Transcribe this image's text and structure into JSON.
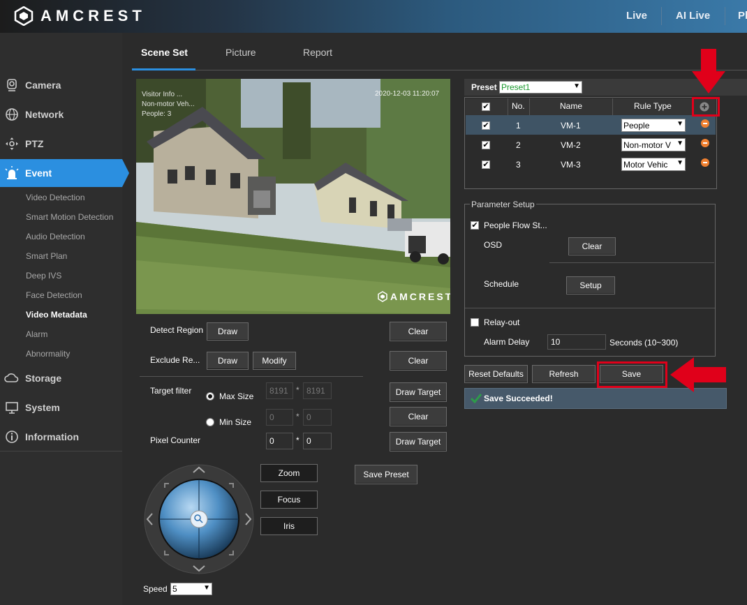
{
  "header": {
    "brand": "AMCREST",
    "nav": [
      "Live",
      "AI Live",
      "Pl"
    ]
  },
  "sidebar": {
    "main": [
      {
        "label": "Camera",
        "icon": "camera-icon"
      },
      {
        "label": "Network",
        "icon": "globe-icon"
      },
      {
        "label": "PTZ",
        "icon": "ptz-icon"
      },
      {
        "label": "Event",
        "icon": "alarm-icon"
      }
    ],
    "sub": [
      "Video Detection",
      "Smart Motion Detection",
      "Audio Detection",
      "Smart Plan",
      "Deep IVS",
      "Face Detection",
      "Video Metadata",
      "Alarm",
      "Abnormality"
    ],
    "bottom": [
      {
        "label": "Storage",
        "icon": "cloud-icon"
      },
      {
        "label": "System",
        "icon": "monitor-icon"
      },
      {
        "label": "Information",
        "icon": "info-icon"
      }
    ]
  },
  "tabs": [
    "Scene Set",
    "Picture",
    "Report"
  ],
  "video": {
    "watermark": "AMCREST",
    "overlay_lines": [
      "Visitor Info ...",
      "Non-motor Veh...",
      "People: 3"
    ],
    "timestamp": "2020-12-03 11:20:07"
  },
  "left": {
    "detect_region": "Detect Region",
    "exclude_region": "Exclude Re...",
    "draw": "Draw",
    "modify": "Modify",
    "clear": "Clear",
    "target_filter": "Target filter",
    "max_size": "Max Size",
    "min_size": "Min Size",
    "max_w": "8191",
    "max_h": "8191",
    "min_w": "0",
    "min_h": "0",
    "star": "*",
    "pixel_counter": "Pixel Counter",
    "pc_w": "0",
    "pc_h": "0",
    "draw_target": "Draw Target",
    "save_preset": "Save Preset",
    "zoom": "Zoom",
    "focus": "Focus",
    "iris": "Iris",
    "speed_label": "Speed",
    "speed": "5"
  },
  "preset": {
    "label": "Preset",
    "value": "Preset1"
  },
  "rules": {
    "headers": [
      "No.",
      "Name",
      "Rule Type"
    ],
    "rows": [
      {
        "no": "1",
        "name": "VM-1",
        "type": "People"
      },
      {
        "no": "2",
        "name": "VM-2",
        "type": "Non-motor V"
      },
      {
        "no": "3",
        "name": "VM-3",
        "type": "Motor Vehic"
      }
    ]
  },
  "params": {
    "legend": "Parameter Setup",
    "people_flow": "People Flow St...",
    "osd": "OSD",
    "clear": "Clear",
    "schedule": "Schedule",
    "setup": "Setup",
    "relay_out": "Relay-out",
    "alarm_delay": "Alarm Delay",
    "delay_value": "10",
    "delay_unit": "Seconds (10~300)"
  },
  "actions": {
    "reset": "Reset Defaults",
    "refresh": "Refresh",
    "save": "Save",
    "status": "Save Succeeded!"
  },
  "colors": {
    "accent": "#2b8fe0",
    "annotation": "#e0001a",
    "selected_row": "#3f5465",
    "success": "#2e9b4a",
    "status_bg": "#46596a"
  }
}
